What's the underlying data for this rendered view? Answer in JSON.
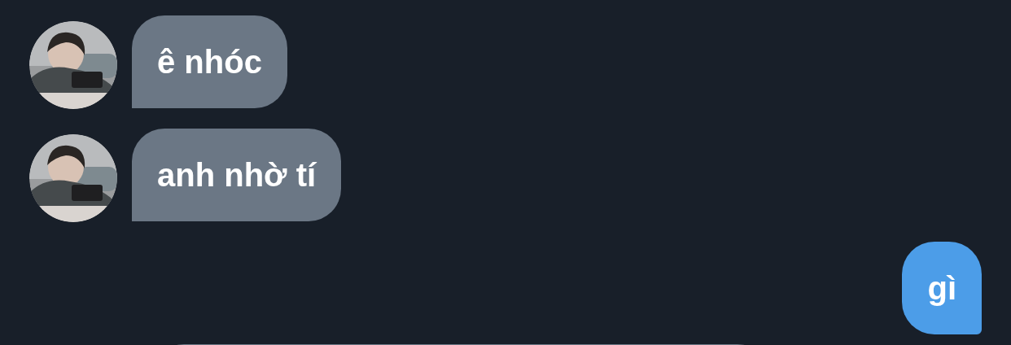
{
  "messages": [
    {
      "kind": "incoming",
      "text": "ê nhóc"
    },
    {
      "kind": "incoming",
      "text": "anh nhờ tí"
    },
    {
      "kind": "outgoing",
      "text": "gì"
    },
    {
      "kind": "incoming_clipped"
    }
  ]
}
